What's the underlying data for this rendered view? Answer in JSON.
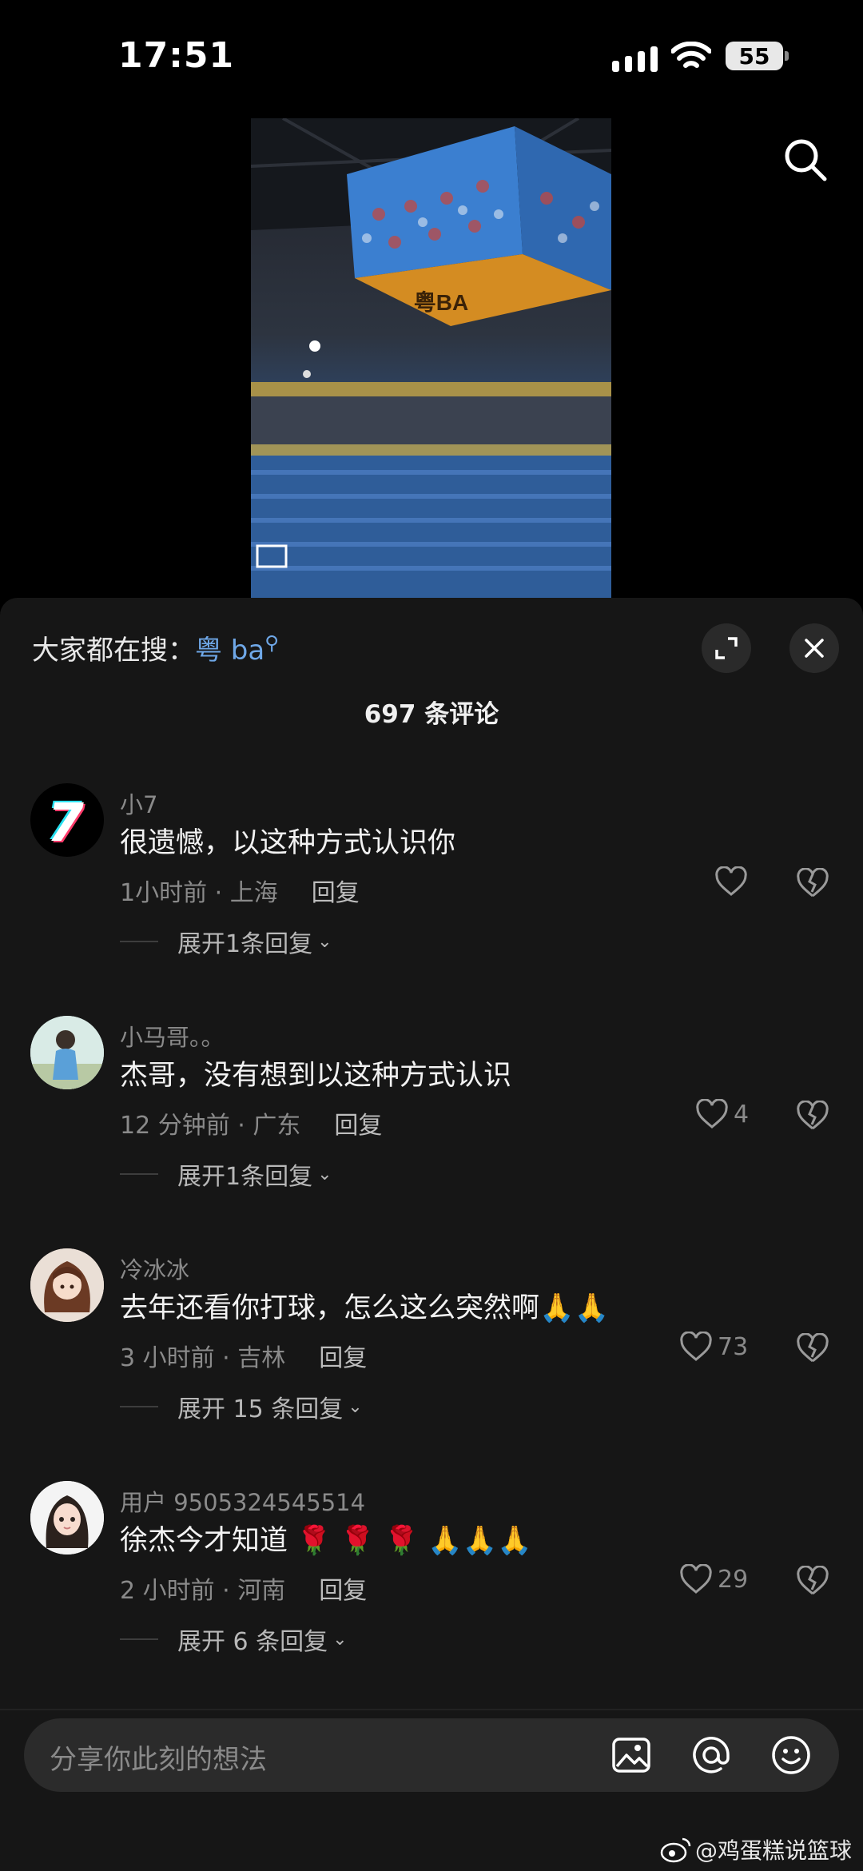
{
  "status": {
    "time": "17:51",
    "battery": "55"
  },
  "search": {
    "trending_prefix": "大家都在搜：",
    "trending_keyword": "粤 ba"
  },
  "video": {
    "banner_text": "粤BA"
  },
  "comments_header": {
    "count_text": "697 条评论"
  },
  "comments": [
    {
      "user": "小7",
      "text": "很遗憾，以这种方式认识你",
      "time_loc": "1小时前 · 上海",
      "reply": "回复",
      "likes": "",
      "expand": "展开1条回复"
    },
    {
      "user": "小马哥。。",
      "text": "杰哥，没有想到以这种方式认识",
      "time_loc": "12 分钟前 · 广东",
      "reply": "回复",
      "likes": "4",
      "expand": "展开1条回复"
    },
    {
      "user": "冷冰冰",
      "text": "去年还看你打球，怎么这么突然啊🙏🙏",
      "time_loc": "3 小时前 · 吉林",
      "reply": "回复",
      "likes": "73",
      "expand": "展开 15 条回复"
    },
    {
      "user": "用户 9505324545514",
      "text": "徐杰今才知道 🌹 🌹 🌹 🙏🙏🙏",
      "time_loc": "2 小时前 · 河南",
      "reply": "回复",
      "likes": "29",
      "expand": "展开 6 条回复"
    }
  ],
  "input": {
    "placeholder": "分享你此刻的想法"
  },
  "watermark": {
    "text": "@鸡蛋糕说篮球"
  },
  "colors": {
    "background": "#000000",
    "sheet": "#161616",
    "keyword": "#6fa8e8",
    "muted": "#8a8a8a"
  }
}
